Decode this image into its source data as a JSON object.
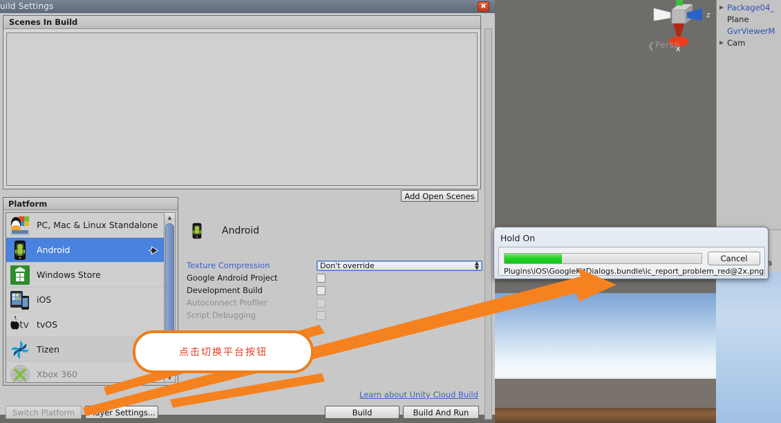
{
  "window": {
    "title": "uild Settings",
    "close_icon": "close-icon"
  },
  "scenes_in_build": {
    "header": "Scenes In Build",
    "items": [],
    "add_open_scenes_label": "Add Open Scenes"
  },
  "platform": {
    "header": "Platform",
    "items": [
      {
        "label": "PC, Mac & Linux Standalone",
        "icon": "standalone-icon",
        "selected": false,
        "disabled": false
      },
      {
        "label": "Android",
        "icon": "android-icon",
        "selected": true,
        "disabled": false
      },
      {
        "label": "Windows Store",
        "icon": "windows-store-icon",
        "selected": false,
        "disabled": false
      },
      {
        "label": "iOS",
        "icon": "ios-icon",
        "selected": false,
        "disabled": false
      },
      {
        "label": "tvOS",
        "icon": "tvos-icon",
        "selected": false,
        "disabled": false
      },
      {
        "label": "Tizen",
        "icon": "tizen-icon",
        "selected": false,
        "disabled": false
      },
      {
        "label": "Xbox 360",
        "icon": "xbox360-icon",
        "selected": false,
        "disabled": true
      }
    ]
  },
  "settings": {
    "platform_title": "Android",
    "texture_compression": {
      "label": "Texture Compression",
      "value": "Don't override"
    },
    "checkboxes": [
      {
        "label": "Google Android Project",
        "checked": false,
        "enabled": true
      },
      {
        "label": "Development Build",
        "checked": false,
        "enabled": true
      },
      {
        "label": "Autoconnect Profiler",
        "checked": false,
        "enabled": false
      },
      {
        "label": "Script Debugging",
        "checked": false,
        "enabled": false
      }
    ],
    "cloud_build_link": "Learn about Unity Cloud Build"
  },
  "buttons": {
    "switch_platform": "Switch Platform",
    "switch_platform_enabled": false,
    "player_settings": "Player Settings...",
    "build": "Build",
    "build_and_run": "Build And Run"
  },
  "dialog": {
    "title": "Hold On",
    "progress_percent": 29,
    "path": "Plugins\\iOS\\GoogleKitDialogs.bundle\\ic_report_problem_red@2x.png",
    "cancel_label": "Cancel"
  },
  "hierarchy": {
    "items": [
      {
        "label": "Package04_",
        "expandable": true,
        "prefab": true
      },
      {
        "label": "Plane",
        "expandable": false,
        "prefab": false
      },
      {
        "label": "GvrViewerM",
        "expandable": false,
        "prefab": true
      },
      {
        "label": "Cam",
        "expandable": true,
        "prefab": false
      }
    ]
  },
  "scene_view": {
    "persp_label": "Persp",
    "axis_z": "z",
    "axis_x": "x",
    "edge_text": "e a"
  },
  "annotation": {
    "callout_text": "点击切换平台按钮",
    "accent_color": "#f07d1a",
    "text_color": "#e03c21"
  }
}
